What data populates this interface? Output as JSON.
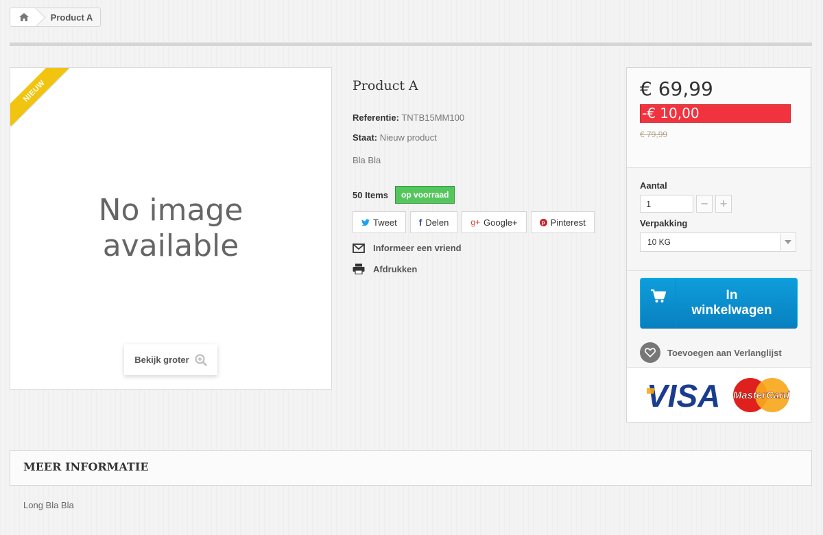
{
  "breadcrumb": {
    "home_icon": "home-icon",
    "current": "Product A"
  },
  "product": {
    "badge": "Nieuw",
    "image_placeholder_line1": "No image",
    "image_placeholder_line2": "available",
    "view_larger": "Bekijk groter",
    "title": "Product A",
    "reference_label": "Referentie:",
    "reference_value": "TNTB15MM100",
    "condition_label": "Staat:",
    "condition_value": "Nieuw product",
    "short_description": "Bla Bla",
    "quantity_available": "50 Items",
    "availability": "op voorraad"
  },
  "social": {
    "tweet": "Tweet",
    "share": "Delen",
    "google": "Google+",
    "pinterest": "Pinterest"
  },
  "actions": {
    "send_to_friend": "Informeer een vriend",
    "print": "Afdrukken"
  },
  "buy_box": {
    "price": "€ 69,99",
    "reduction": "-€ 10,00",
    "old_price": "€ 79,99",
    "quantity_label": "Aantal",
    "quantity_value": "1",
    "packaging_label": "Verpakking",
    "packaging_selected": "10 KG",
    "add_to_cart_line1": "In",
    "add_to_cart_line2": "winkelwagen",
    "wishlist": "Toevoegen aan Verlanglijst",
    "card_visa": "VISA",
    "card_mastercard": "MasterCard"
  },
  "more_info": {
    "title": "Meer informatie",
    "content": "Long Bla Bla"
  },
  "colors": {
    "stock_green": "#55c65e",
    "reduction_red": "#f13340",
    "cart_blue": "#0f9ddb",
    "ribbon_yellow": "#f1c40f"
  }
}
